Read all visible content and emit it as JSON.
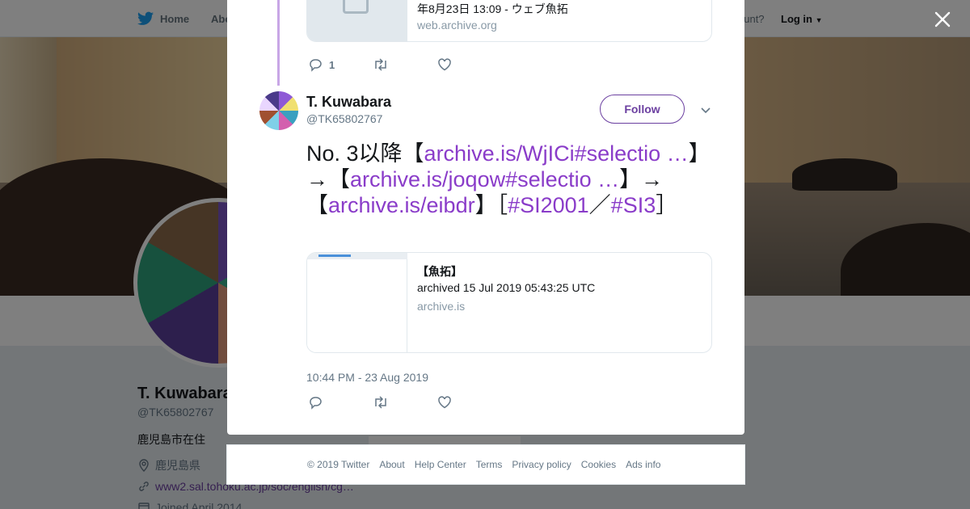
{
  "nav": {
    "home_label": "Home",
    "about_label": "Abo",
    "account_prompt": "ccount?",
    "login_label": "Log in"
  },
  "profile": {
    "name": "T. Kuwabara",
    "handle": "@TK65802767",
    "bio": "鹿児島市在住",
    "location": "鹿児島県",
    "url": "www2.sal.tohoku.ac.jp/soc/english/cg…",
    "joined": "Joined April 2014",
    "ads_fragment": "Ads info"
  },
  "previous_tweet": {
    "card_desc": "年8月23日 13:09 - ウェブ魚拓",
    "card_domain": "web.archive.org",
    "reply_count": "1"
  },
  "tweet": {
    "author_name": "T. Kuwabara",
    "author_handle": "@TK65802767",
    "follow_label": "Follow",
    "text": {
      "p1": "No. 3以降【",
      "link1": "archive.is/WjICi#selectio …",
      "p2": "】→【",
      "link2": "archive.is/joqow#selectio …",
      "p3": "】→【",
      "link3": "archive.is/eibdr",
      "p4": "】［",
      "tag1": "#SI2001",
      "p5": "／",
      "tag2": "#SI3",
      "p6": "］"
    },
    "card": {
      "title": "【魚拓】",
      "desc": "archived 15 Jul 2019 05:43:25 UTC",
      "domain": "archive.is"
    },
    "timestamp": "10:44 PM - 23 Aug 2019"
  },
  "footer": {
    "copyright": "© 2019 Twitter",
    "links": [
      "About",
      "Help Center",
      "Terms",
      "Privacy policy",
      "Cookies",
      "Ads info"
    ]
  },
  "colors": {
    "link_purple": "#8a3cc9",
    "follow_purple": "#6b3fa0",
    "thread_line": "#c8a6e6",
    "muted_text": "#657786"
  },
  "icons": {
    "nav": "twitter-bird-icon",
    "close": "close-icon",
    "reply": "reply-icon",
    "retweet": "retweet-icon",
    "like": "heart-icon",
    "caret": "chevron-down-icon",
    "location": "location-pin-icon",
    "link": "link-icon",
    "calendar": "calendar-icon"
  }
}
